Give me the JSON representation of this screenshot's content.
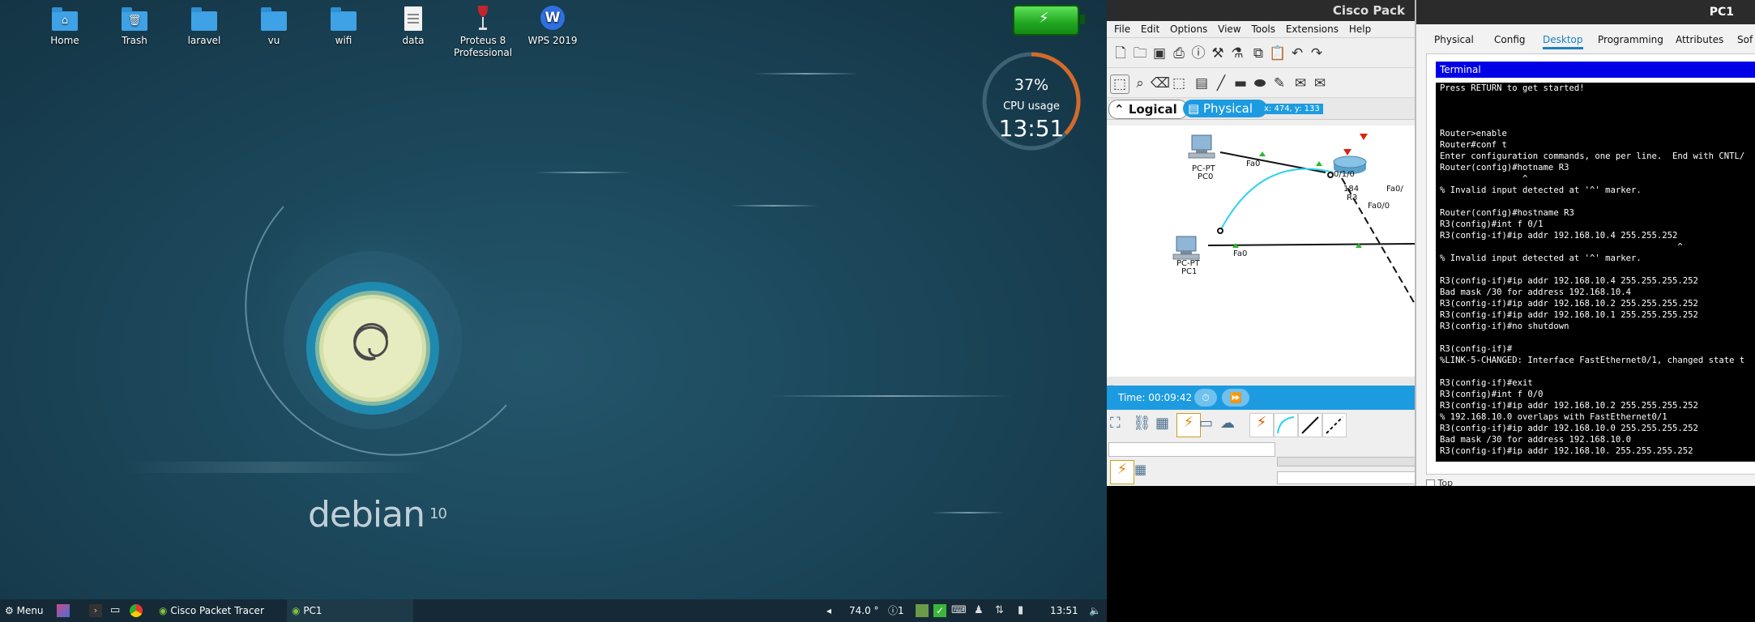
{
  "desktop": {
    "icons": [
      {
        "name": "desktop-icon-home",
        "label": "Home"
      },
      {
        "name": "desktop-icon-trash",
        "label": "Trash"
      },
      {
        "name": "desktop-icon-laravel",
        "label": "laravel"
      },
      {
        "name": "desktop-icon-vu",
        "label": "vu"
      },
      {
        "name": "desktop-icon-wifi",
        "label": "wifi"
      },
      {
        "name": "desktop-icon-data",
        "label": "data"
      },
      {
        "name": "desktop-icon-proteus",
        "label": "Proteus 8 Professional"
      },
      {
        "name": "desktop-icon-wps",
        "label": "WPS 2019"
      }
    ],
    "wallpaper_brand": "debian",
    "wallpaper_version": "10",
    "cpu_widget": {
      "percent_label": "37%",
      "percent": 37,
      "label": "CPU usage",
      "clock": "13:51"
    }
  },
  "taskbar": {
    "menu_label": "Menu",
    "apps": [
      {
        "label": "Cisco Packet Tracer"
      },
      {
        "label": "PC1"
      }
    ],
    "temperature": "74.0 °",
    "notifications": "1",
    "time": "13:51"
  },
  "packet_tracer": {
    "title": "Cisco Pack",
    "menu": [
      "File",
      "Edit",
      "Options",
      "View",
      "Tools",
      "Extensions",
      "Help"
    ],
    "menu_underline": [
      "F",
      "E",
      "O",
      "V",
      "T",
      "x",
      "H"
    ],
    "logical_tab": "Logical",
    "physical_tab": "Physical",
    "coords": "x: 474, y: 133",
    "time": "Time: 00:09:42",
    "topology": {
      "devices": [
        {
          "type": "PC-PT",
          "name": "PC0",
          "port": "Fa0"
        },
        {
          "type": "PC-PT",
          "name": "PC1",
          "port": "Fa0"
        },
        {
          "type": "184",
          "name": "R3",
          "ports": [
            "0/1/0",
            "Fa0/",
            "Fa0/0"
          ]
        }
      ]
    }
  },
  "pc1": {
    "title": "PC1",
    "tabs": [
      "Physical",
      "Config",
      "Desktop",
      "Programming",
      "Attributes",
      "Sof"
    ],
    "active_tab": "Desktop",
    "terminal_title": "Terminal",
    "terminal_lines": [
      "Press RETURN to get started!",
      "",
      "",
      "",
      "Router>enable",
      "Router#conf t",
      "Enter configuration commands, one per line.  End with CNTL/",
      "Router(config)#hotname R3",
      "                ^",
      "% Invalid input detected at '^' marker.",
      "",
      "Router(config)#hostname R3",
      "R3(config)#int f 0/1",
      "R3(config-if)#ip addr 192.168.10.4 255.255.252",
      "                                              ^",
      "% Invalid input detected at '^' marker.",
      "",
      "R3(config-if)#ip addr 192.168.10.4 255.255.255.252",
      "Bad mask /30 for address 192.168.10.4",
      "R3(config-if)#ip addr 192.168.10.2 255.255.255.252",
      "R3(config-if)#ip addr 192.168.10.1 255.255.255.252",
      "R3(config-if)#no shutdown",
      "",
      "R3(config-if)#",
      "%LINK-5-CHANGED: Interface FastEthernet0/1, changed state t",
      "",
      "R3(config-if)#exit",
      "R3(config)#int f 0/0",
      "R3(config-if)#ip addr 192.168.10.2 255.255.255.252",
      "% 192.168.10.0 overlaps with FastEthernet0/1",
      "R3(config-if)#ip addr 192.168.10.0 255.255.255.252",
      "Bad mask /30 for address 192.168.10.0",
      "R3(config-if)#ip addr 192.168.10. 255.255.255.252"
    ],
    "footer_checkbox": "Top"
  },
  "colors": {
    "accent": "#1d9be0",
    "terminal_bar": "#0000e6",
    "battery": "#2cc22c",
    "cpu_ring": "#d46a2a"
  }
}
